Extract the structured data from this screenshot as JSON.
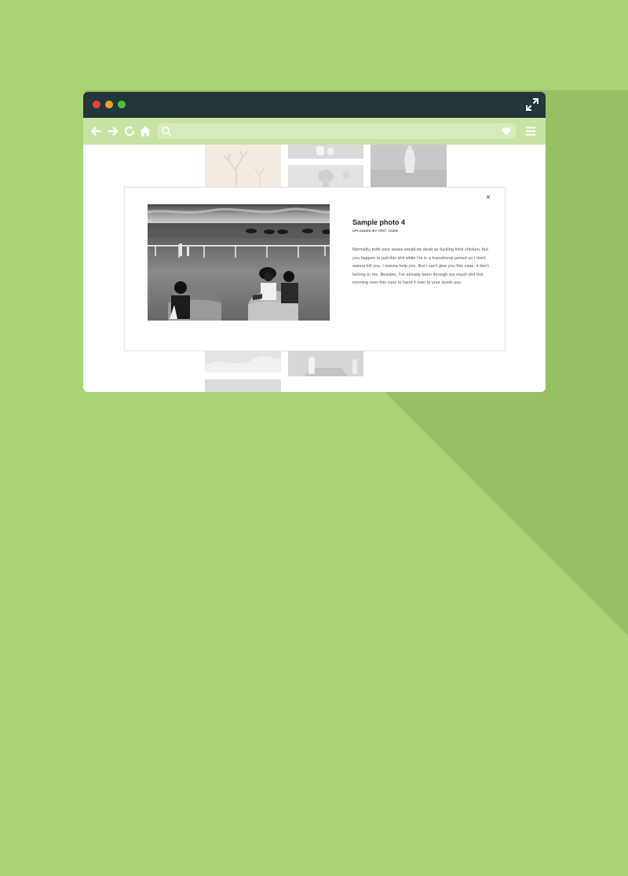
{
  "browser": {
    "url_value": "",
    "icons": [
      "back-arrow-icon",
      "forward-arrow-icon",
      "reload-icon",
      "home-icon",
      "search-icon",
      "heart-icon",
      "menu-icon",
      "expand-icon"
    ]
  },
  "modal": {
    "close_label": "×",
    "title": "Sample photo 4",
    "uploaded_by": "UPLOADED BY TEST_USER",
    "description": "Normally, both your asses would be dead as fucking fried chicken, but you happen to pull this shit while I'm in a transitional period so I don't wanna kill you, I wanna help you. But I can't give you this case, it don't belong to me. Besides, I've already been through too much shit this morning over this case to hand it over to your dumb ass."
  },
  "colors": {
    "background": "#a9d473",
    "titlebar": "#23363a",
    "toolbar": "#c7e3a3",
    "close_dot": "#e6423b",
    "minimize_dot": "#e7a42e",
    "zoom_dot": "#4dc13e"
  }
}
